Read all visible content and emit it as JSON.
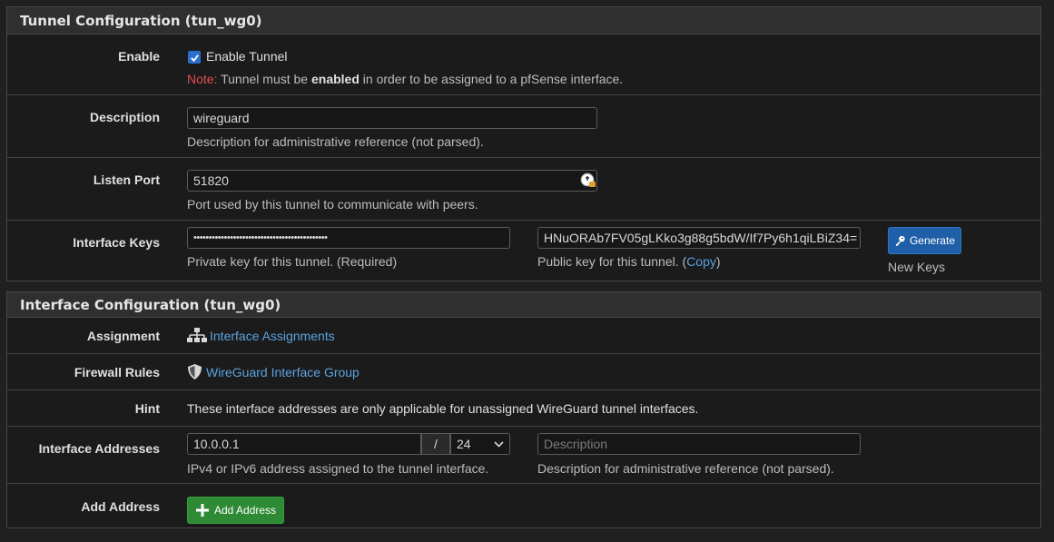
{
  "tunnel": {
    "title": "Tunnel Configuration (tun_wg0)",
    "enable": {
      "label": "Enable",
      "checkbox_label": "Enable Tunnel",
      "checked": true,
      "note_prefix": "Note:",
      "note_text_1": " Tunnel must be ",
      "note_bold": "enabled",
      "note_text_2": " in order to be assigned to a pfSense interface."
    },
    "description": {
      "label": "Description",
      "value": "wireguard",
      "help": "Description for administrative reference (not parsed)."
    },
    "listen_port": {
      "label": "Listen Port",
      "value": "51820",
      "help": "Port used by this tunnel to communicate with peers."
    },
    "interface_keys": {
      "label": "Interface Keys",
      "private_value": "••••••••••••••••••••••••••••••••••••••••••••",
      "private_help": "Private key for this tunnel. (Required)",
      "public_value": "HNuORAb7FV05gLKko3g88g5bdW/If7Py6h1qiLBiZ34=",
      "public_help_prefix": "Public key for this tunnel. (",
      "copy_link": "Copy",
      "public_help_suffix": ")",
      "generate_button": "Generate",
      "new_keys_label": "New Keys"
    }
  },
  "interface": {
    "title": "Interface Configuration (tun_wg0)",
    "assignment": {
      "label": "Assignment",
      "link": "Interface Assignments",
      "icon": "sitemap-icon"
    },
    "firewall_rules": {
      "label": "Firewall Rules",
      "link": "WireGuard Interface Group",
      "icon": "shield-icon"
    },
    "hint": {
      "label": "Hint",
      "text": "These interface addresses are only applicable for unassigned WireGuard tunnel interfaces."
    },
    "addresses": {
      "label": "Interface Addresses",
      "address_value": "10.0.0.1",
      "slash": "/",
      "cidr_value": "24",
      "description_placeholder": "Description",
      "address_help": "IPv4 or IPv6 address assigned to the tunnel interface.",
      "description_help": "Description for administrative reference (not parsed)."
    },
    "add_address": {
      "label": "Add Address",
      "button": "Add Address"
    }
  },
  "colors": {
    "background": "#202020",
    "panel_header": "#2f2f2f",
    "link": "#5aa3e0",
    "note": "#e05050",
    "generate_button": "#1f5fa8",
    "add_button": "#2e8a34"
  }
}
